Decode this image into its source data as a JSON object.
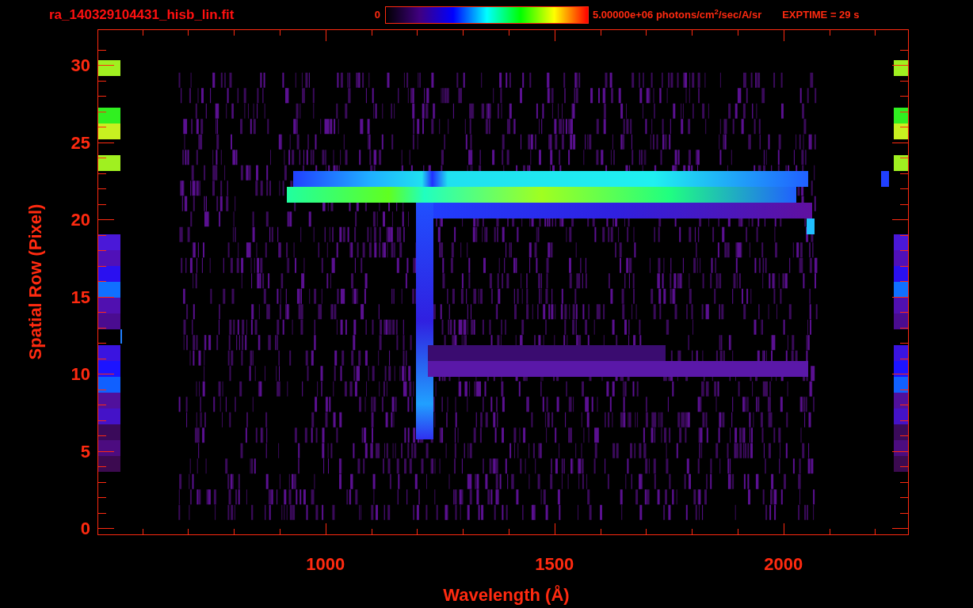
{
  "title": "ra_140329104431_hisb_lin.fit",
  "colorbar": {
    "min_label": "0",
    "max_label": "5.00000e+06 photons/cm$^{2}$/sec/A/sr"
  },
  "exposure": "EXPTIME = 29 s",
  "plot": {
    "ylabel": "Spatial Row (Pixel)",
    "xlabel": "Wavelength (Å)",
    "yticks": [
      "30",
      "25",
      "20",
      "15",
      "10",
      "5",
      "0"
    ],
    "xticks": [
      "1000",
      "1500",
      "2000"
    ]
  }
}
